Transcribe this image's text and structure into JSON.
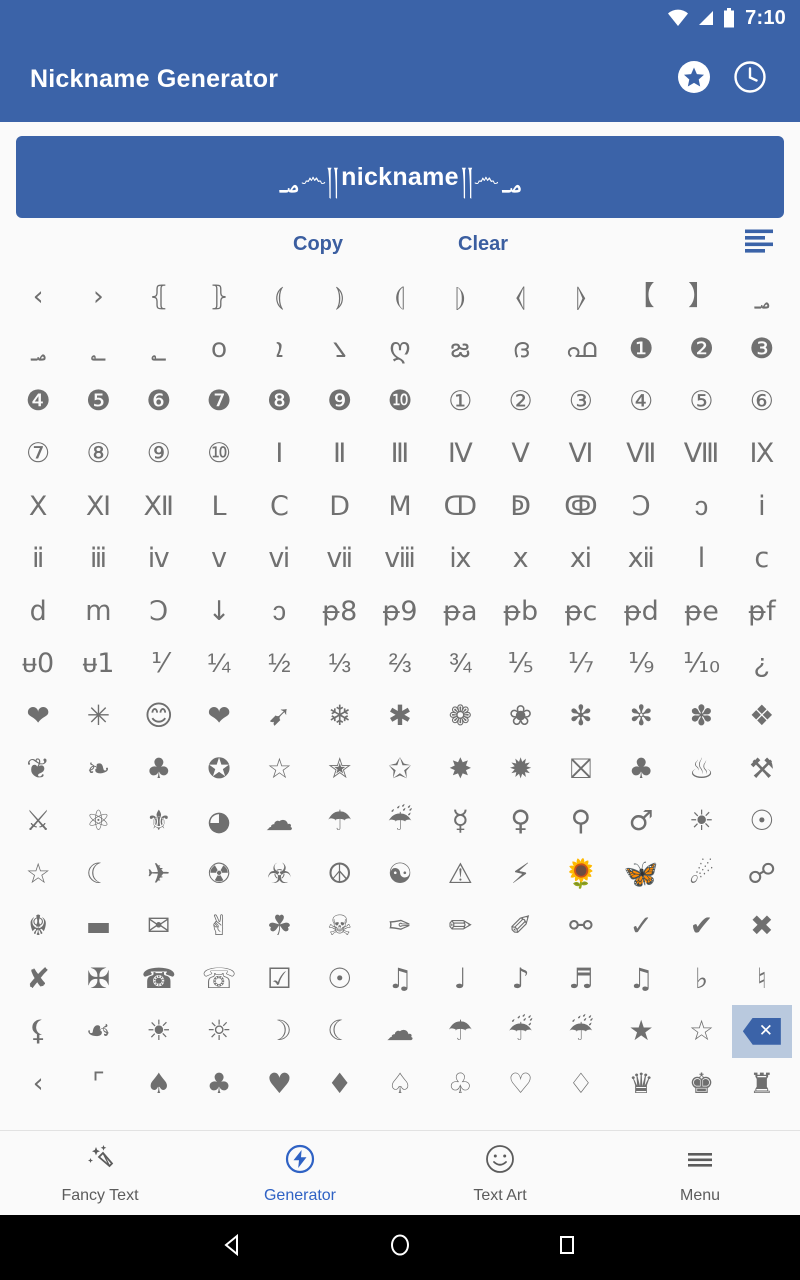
{
  "status_bar": {
    "time": "7:10",
    "icons": [
      "wifi-icon",
      "signal-icon",
      "battery-icon"
    ]
  },
  "app_bar": {
    "title": "Nickname Generator",
    "actions": [
      {
        "name": "favorites-star-icon",
        "label": "Favorites"
      },
      {
        "name": "history-clock-icon",
        "label": "History"
      }
    ]
  },
  "display": {
    "ornament_left_big": "؃",
    "ornament_left": "؃",
    "prefix": "෴།།",
    "text": "nickname",
    "suffix": "།།෴",
    "ornament_right": "؃"
  },
  "actions": {
    "copy_label": "Copy",
    "clear_label": "Clear",
    "list_icon": "format-list-icon"
  },
  "symbol_grid": {
    "columns": 13,
    "rows": [
      [
        "‹",
        "›",
        "⦃",
        "⦄",
        "⦅",
        "⦆",
        "⦇",
        "⦈",
        "⦉",
        "⦊",
        "【",
        "】",
        "؃"
      ],
      [
        "؃",
        "؂",
        "؂",
        "꧆",
        "ܐ",
        "꧈",
        "ღ",
        "జ",
        "ദ",
        "ഫ",
        "❶",
        "❷",
        "❸"
      ],
      [
        "❹",
        "❺",
        "❻",
        "❼",
        "❽",
        "❾",
        "❿",
        "①",
        "②",
        "③",
        "④",
        "⑤",
        "⑥"
      ],
      [
        "⑦",
        "⑧",
        "⑨",
        "⑩",
        "Ⅰ",
        "Ⅱ",
        "Ⅲ",
        "Ⅳ",
        "Ⅴ",
        "Ⅵ",
        "Ⅶ",
        "Ⅷ",
        "Ⅸ"
      ],
      [
        "Ⅹ",
        "Ⅺ",
        "Ⅻ",
        "Ⅼ",
        "Ⅽ",
        "Ⅾ",
        "Ⅿ",
        "ↀ",
        "ↁ",
        "ↂ",
        "Ↄ",
        "ↄ",
        "ⅰ"
      ],
      [
        "ⅱ",
        "ⅲ",
        "ⅳ",
        "ⅴ",
        "ⅵ",
        "ⅶ",
        "ⅷ",
        "ⅸ",
        "ⅹ",
        "ⅺ",
        "ⅻ",
        "ⅼ",
        "ⅽ"
      ],
      [
        "ⅾ",
        "ⅿ",
        "Ↄ",
        "↓",
        "ↄ",
        "ᵽ8",
        "ᵽ9",
        "ᵽa",
        "ᵽb",
        "ᵽc",
        "ᵽd",
        "ᵽe",
        "ᵽf"
      ],
      [
        "ᵾ0",
        "ᵾ1",
        "⅟",
        "¼",
        "½",
        "⅓",
        "⅔",
        "¾",
        "⅕",
        "⅐",
        "⅑",
        "⅒",
        "¿"
      ],
      [
        "❤",
        "✳",
        "😊",
        "❤",
        "➹",
        "❄",
        "✱",
        "❁",
        "❀",
        "✻",
        "✼",
        "✽",
        "❖"
      ],
      [
        "❦",
        "❧",
        "♣",
        "✪",
        "☆",
        "✭",
        "✩",
        "✸",
        "✹",
        "⛝",
        "♣",
        "♨",
        "⚒"
      ],
      [
        "⚔",
        "⚛",
        "⚜",
        "◕",
        "☁",
        "☂",
        "☔",
        "☿",
        "♀",
        "⚲",
        "♂",
        "☀",
        "☉"
      ],
      [
        "☆",
        "☾",
        "✈",
        "☢",
        "☣",
        "☮",
        "☯",
        "⚠",
        "⚡",
        "🌻",
        "🦋",
        "☄",
        "☍"
      ],
      [
        "☬",
        "▬",
        "✉",
        "✌",
        "☘",
        "☠",
        "✑",
        "✏",
        "✐",
        "⚯",
        "✓",
        "✔",
        "✖"
      ],
      [
        "✘",
        "✠",
        "☎",
        "☏",
        "☑",
        "☉",
        "♫",
        "♩",
        "♪",
        "♬",
        "♫",
        "♭",
        "♮"
      ],
      [
        "⚸",
        "☙",
        "☀",
        "☼",
        "☽",
        "☾",
        "☁",
        "☂",
        "☔",
        "☔",
        "★",
        "☆",
        "backspace"
      ],
      [
        "‹",
        "⌜",
        "♠",
        "♣",
        "♥",
        "♦",
        "♤",
        "♧",
        "♡",
        "♢",
        "♛",
        "♚",
        "♜"
      ]
    ],
    "pressed_cell": {
      "row": 14,
      "col": 12,
      "name": "backspace-key"
    }
  },
  "bottom_nav": {
    "items": [
      {
        "label": "Fancy Text",
        "icon": "magic-wand-icon",
        "active": false
      },
      {
        "label": "Generator",
        "icon": "lightning-bolt-icon",
        "active": true
      },
      {
        "label": "Text Art",
        "icon": "smiley-face-icon",
        "active": false
      },
      {
        "label": "Menu",
        "icon": "hamburger-menu-icon",
        "active": false
      }
    ],
    "active_color": "#2f62c4",
    "inactive_color": "#5c5c5c"
  },
  "android_nav": {
    "buttons": [
      {
        "name": "back-button",
        "icon": "triangle-left-icon"
      },
      {
        "name": "home-button",
        "icon": "circle-icon"
      },
      {
        "name": "recents-button",
        "icon": "square-icon"
      }
    ]
  },
  "colors": {
    "primary": "#3b63a8",
    "background": "#fafafa",
    "symbol": "#6f6f6f",
    "accent": "#2f62c4"
  }
}
